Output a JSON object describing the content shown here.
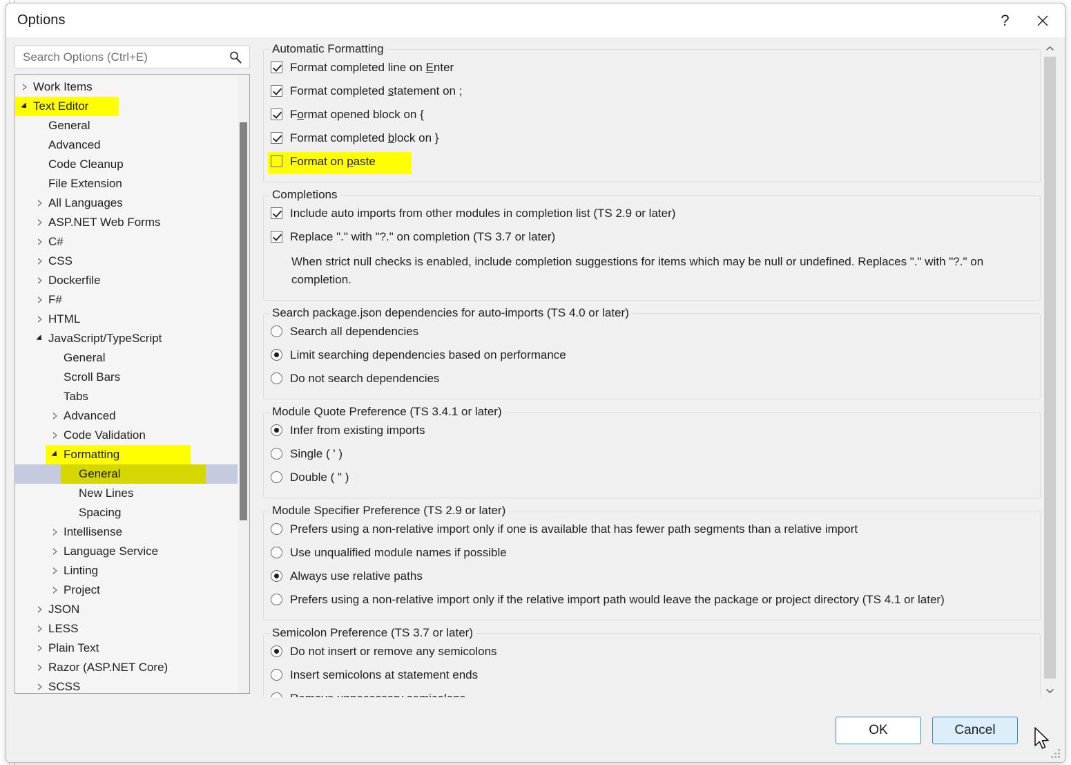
{
  "window": {
    "title": "Options",
    "help_label": "?",
    "close_label": "×"
  },
  "search": {
    "placeholder": "Search Options (Ctrl+E)",
    "value": "",
    "icon": "search-icon"
  },
  "tree": {
    "items": [
      {
        "label": "Work Items",
        "indent": 0,
        "state": "collapsed",
        "highlight": false,
        "selected": false
      },
      {
        "label": "Text Editor",
        "indent": 0,
        "state": "expanded",
        "highlight": true,
        "selected": false,
        "hl_width": 150
      },
      {
        "label": "General",
        "indent": 1,
        "state": "none",
        "highlight": false,
        "selected": false
      },
      {
        "label": "Advanced",
        "indent": 1,
        "state": "none",
        "highlight": false,
        "selected": false
      },
      {
        "label": "Code Cleanup",
        "indent": 1,
        "state": "none",
        "highlight": false,
        "selected": false
      },
      {
        "label": "File Extension",
        "indent": 1,
        "state": "none",
        "highlight": false,
        "selected": false
      },
      {
        "label": "All Languages",
        "indent": 1,
        "state": "collapsed",
        "highlight": false,
        "selected": false
      },
      {
        "label": "ASP.NET Web Forms",
        "indent": 1,
        "state": "collapsed",
        "highlight": false,
        "selected": false
      },
      {
        "label": "C#",
        "indent": 1,
        "state": "collapsed",
        "highlight": false,
        "selected": false
      },
      {
        "label": "CSS",
        "indent": 1,
        "state": "collapsed",
        "highlight": false,
        "selected": false
      },
      {
        "label": "Dockerfile",
        "indent": 1,
        "state": "collapsed",
        "highlight": false,
        "selected": false
      },
      {
        "label": "F#",
        "indent": 1,
        "state": "collapsed",
        "highlight": false,
        "selected": false
      },
      {
        "label": "HTML",
        "indent": 1,
        "state": "collapsed",
        "highlight": false,
        "selected": false
      },
      {
        "label": "JavaScript/TypeScript",
        "indent": 1,
        "state": "expanded",
        "highlight": false,
        "selected": false
      },
      {
        "label": "General",
        "indent": 2,
        "state": "none",
        "highlight": false,
        "selected": false
      },
      {
        "label": "Scroll Bars",
        "indent": 2,
        "state": "none",
        "highlight": false,
        "selected": false
      },
      {
        "label": "Tabs",
        "indent": 2,
        "state": "none",
        "highlight": false,
        "selected": false
      },
      {
        "label": "Advanced",
        "indent": 2,
        "state": "collapsed",
        "highlight": false,
        "selected": false
      },
      {
        "label": "Code Validation",
        "indent": 2,
        "state": "collapsed",
        "highlight": false,
        "selected": false
      },
      {
        "label": "Formatting",
        "indent": 2,
        "state": "expanded",
        "highlight": true,
        "selected": false,
        "hl_width": 210
      },
      {
        "label": "General",
        "indent": 3,
        "state": "none",
        "highlight": true,
        "selected": true,
        "hl_width": 210
      },
      {
        "label": "New Lines",
        "indent": 3,
        "state": "none",
        "highlight": false,
        "selected": false
      },
      {
        "label": "Spacing",
        "indent": 3,
        "state": "none",
        "highlight": false,
        "selected": false
      },
      {
        "label": "Intellisense",
        "indent": 2,
        "state": "collapsed",
        "highlight": false,
        "selected": false
      },
      {
        "label": "Language Service",
        "indent": 2,
        "state": "collapsed",
        "highlight": false,
        "selected": false
      },
      {
        "label": "Linting",
        "indent": 2,
        "state": "collapsed",
        "highlight": false,
        "selected": false
      },
      {
        "label": "Project",
        "indent": 2,
        "state": "collapsed",
        "highlight": false,
        "selected": false
      },
      {
        "label": "JSON",
        "indent": 1,
        "state": "collapsed",
        "highlight": false,
        "selected": false
      },
      {
        "label": "LESS",
        "indent": 1,
        "state": "collapsed",
        "highlight": false,
        "selected": false
      },
      {
        "label": "Plain Text",
        "indent": 1,
        "state": "collapsed",
        "highlight": false,
        "selected": false
      },
      {
        "label": "Razor (ASP.NET Core)",
        "indent": 1,
        "state": "collapsed",
        "highlight": false,
        "selected": false
      },
      {
        "label": "SCSS",
        "indent": 1,
        "state": "collapsed",
        "highlight": false,
        "selected": false
      }
    ]
  },
  "groups": [
    {
      "id": "automatic-formatting",
      "legend": "Automatic Formatting",
      "options": [
        {
          "type": "checkbox",
          "checked": true,
          "text": "Format completed line on Enter",
          "accel": "E",
          "highlight": false
        },
        {
          "type": "checkbox",
          "checked": true,
          "text": "Format completed statement on ;",
          "accel": "s",
          "highlight": false
        },
        {
          "type": "checkbox",
          "checked": true,
          "text": "Format opened block on {",
          "accel": "o",
          "highlight": false
        },
        {
          "type": "checkbox",
          "checked": true,
          "text": "Format completed block on }",
          "accel": "b",
          "highlight": false
        },
        {
          "type": "checkbox",
          "checked": false,
          "text": "Format on paste",
          "accel": "p",
          "highlight": true,
          "hl_width": 208
        }
      ]
    },
    {
      "id": "completions",
      "legend": "Completions",
      "options": [
        {
          "type": "checkbox",
          "checked": true,
          "text": "Include auto imports from other modules in completion list (TS 2.9 or later)",
          "highlight": false
        },
        {
          "type": "checkbox",
          "checked": true,
          "text": "Replace \".\" with \"?.\" on completion (TS 3.7 or later)",
          "highlight": false
        }
      ],
      "description": "When strict null checks is enabled, include completion suggestions for items which may be null or undefined. Replaces \".\" with \"?.\" on completion."
    },
    {
      "id": "search-packagejson-dependencies",
      "legend": "Search package.json dependencies for auto-imports (TS 4.0 or later)",
      "options": [
        {
          "type": "radio",
          "checked": false,
          "text": "Search all dependencies",
          "highlight": false
        },
        {
          "type": "radio",
          "checked": true,
          "text": "Limit searching dependencies based on performance",
          "highlight": false
        },
        {
          "type": "radio",
          "checked": false,
          "text": "Do not search dependencies",
          "highlight": false
        }
      ]
    },
    {
      "id": "module-quote-preference",
      "legend": "Module Quote Preference (TS 3.4.1 or later)",
      "options": [
        {
          "type": "radio",
          "checked": true,
          "text": "Infer from existing imports",
          "highlight": false
        },
        {
          "type": "radio",
          "checked": false,
          "text": "Single ( ' )",
          "highlight": false
        },
        {
          "type": "radio",
          "checked": false,
          "text": "Double ( \" )",
          "highlight": false
        }
      ]
    },
    {
      "id": "module-specifier-preference",
      "legend": "Module Specifier Preference (TS 2.9 or later)",
      "options": [
        {
          "type": "radio",
          "checked": false,
          "text": "Prefers using a non-relative import only if one is available that has fewer path segments than a relative import",
          "highlight": false
        },
        {
          "type": "radio",
          "checked": false,
          "text": "Use unqualified module names if possible",
          "highlight": false
        },
        {
          "type": "radio",
          "checked": true,
          "text": "Always use relative paths",
          "highlight": false
        },
        {
          "type": "radio",
          "checked": false,
          "text": "Prefers using a non-relative import only if the relative import path would leave the package or project directory (TS 4.1 or later)",
          "highlight": false
        }
      ]
    },
    {
      "id": "semicolon-preference",
      "legend": "Semicolon Preference (TS 3.7 or later)",
      "options": [
        {
          "type": "radio",
          "checked": true,
          "text": "Do not insert or remove any semicolons",
          "highlight": false
        },
        {
          "type": "radio",
          "checked": false,
          "text": "Insert semicolons at statement ends",
          "highlight": false
        },
        {
          "type": "radio",
          "checked": false,
          "text": "Remove unnecessary semicolons",
          "highlight": false
        }
      ]
    }
  ],
  "footer": {
    "ok_label": "OK",
    "cancel_label": "Cancel"
  },
  "colors": {
    "highlight_yellow": "#ffff00",
    "selection_blue": "#c6cade",
    "accent_blue": "#3d8bcd",
    "cancel_hover": "#ddeefb"
  }
}
